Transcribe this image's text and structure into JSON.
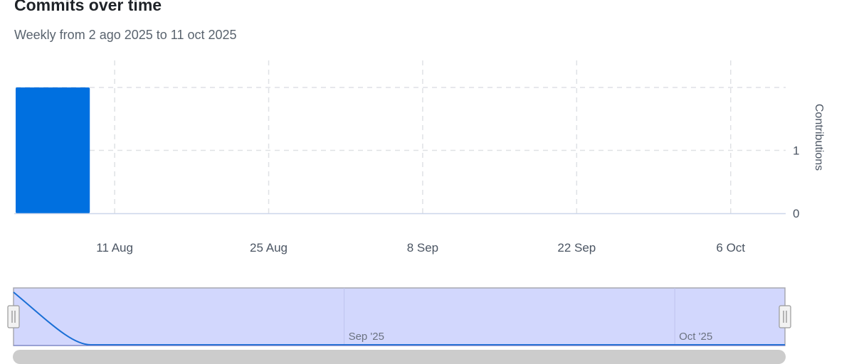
{
  "title": "Commits over time",
  "subtitle": "Weekly from 2 ago 2025 to 11 oct 2025",
  "chart_data": {
    "type": "bar",
    "x_start": "2025-08-02",
    "x_end": "2025-10-11",
    "bars": [
      {
        "week_start": "2025-08-02",
        "week_end": "2025-08-09",
        "value": 2
      }
    ],
    "y_ticks": [
      "0",
      "1"
    ],
    "ylim": [
      0,
      2
    ],
    "ylabel": "Contributions",
    "x_ticks": [
      {
        "date": "2025-08-11",
        "label": "11 Aug"
      },
      {
        "date": "2025-08-25",
        "label": "25 Aug"
      },
      {
        "date": "2025-09-08",
        "label": "8 Sep"
      },
      {
        "date": "2025-09-22",
        "label": "22 Sep"
      },
      {
        "date": "2025-10-06",
        "label": "6 Oct"
      }
    ],
    "grid": true,
    "bar_color": "#0070e0"
  },
  "navigator": {
    "labels": [
      {
        "date": "2025-09-01",
        "label": "Sep '25"
      },
      {
        "date": "2025-10-01",
        "label": "Oct '25"
      }
    ],
    "series": [
      {
        "date": "2025-08-02",
        "value": 2
      },
      {
        "date": "2025-08-09",
        "value": 0
      },
      {
        "date": "2025-10-11",
        "value": 0
      }
    ],
    "fill_color": "#d2d7fd",
    "line_color": "#1a6fd6"
  }
}
